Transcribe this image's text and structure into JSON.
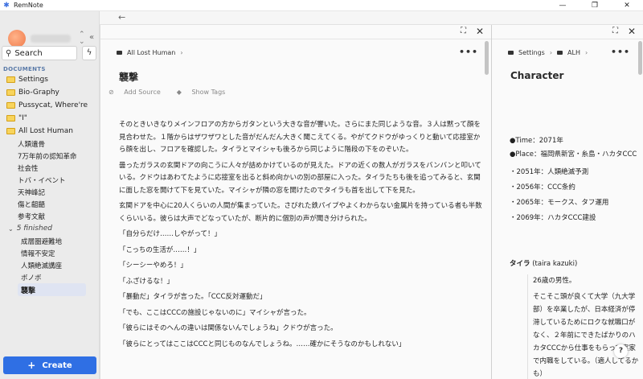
{
  "window": {
    "title": "RemNote",
    "minimize": "—",
    "restore": "❐",
    "close": "✕"
  },
  "sidebar": {
    "search_label": "Search",
    "docs_header": "DOCUMENTS",
    "create_label": "Create",
    "items": [
      {
        "label": "Settings",
        "type": "folder"
      },
      {
        "label": "Bio-Graphy",
        "type": "folder"
      },
      {
        "label": "Pussycat, Where're",
        "type": "folder"
      },
      {
        "label": "\"I\"",
        "type": "folder"
      },
      {
        "label": "All Lost Human",
        "type": "folder"
      }
    ],
    "sub_items": [
      "人類遺骨",
      "7万年前の認知革命",
      "社会性",
      "トバ・イベント",
      "天神峰記",
      "傷と齟齬",
      "参考文献"
    ],
    "finished_label": "5 finished",
    "finished_items": [
      "成層圏避難地",
      "情報不安定",
      "人類絶滅講座",
      "ボノボ"
    ],
    "active_item": "襲撃"
  },
  "main_pane": {
    "breadcrumb": [
      "All Lost Human"
    ],
    "title": "襲撃",
    "add_source": "Add Source",
    "show_tags": "Show Tags",
    "paragraphs": [
      "そのときいきなりメインフロアの方からガタンという大きな音が響いた。さらにまた同じような音。３人は黙って顔を見合わせた。１階からはザワザワとした音がだんだん大きく聞こえてくる。やがてクドウがゆっくりと動いて応接室から顔を出し、フロアを確認した。タイラとマイシャも後ろから同じように階段の下をのぞいた。",
      "曇ったガラスの玄関ドアの向こうに人々が詰めかけているのが見えた。ドアの近くの数人がガラスをバンバンと叩いている。クドウはあわてたように応接室を出ると斜め向かいの別の部屋に入った。タイラたちも後を追ってみると、玄関に面した窓を開けて下を見ていた。マイシャが隣の窓を開けたのでタイラも首を出して下を見た。",
      "玄関ドアを中心に20人くらいの人間が集まっていた。さびれた鉄パイプやよくわからない金属片を持っている者も半数くらいいる。彼らは大声でどなっていたが、断片的に個別の声が聞き分けられた。",
      "「自分らだけ……しやがって！」",
      "「こっちの生活が……！」",
      "「シーシーやめろ！」",
      "「ふざけるな！」",
      "「暴動だ」タイラが言った。「CCC反対運動だ」",
      "「でも、ここはCCCの施設じゃないのに」マイシャが言った。",
      "「彼らにはそのへんの違いは関係ないんでしょうね」クドウが言った。",
      "「彼らにとってはここはCCCと同じものなんでしょうね。……確かにそうなのかもしれない」"
    ]
  },
  "side_pane": {
    "breadcrumb": [
      "Settings",
      "ALH"
    ],
    "title": "Character",
    "lines": [
      "●Time：2071年",
      "●Place：福岡県新宮・糸島・ハカタCCC",
      "・2051年：人類絶滅予測",
      "・2056年：CCC条約",
      "・2065年：モークス、タフ運用",
      "・2069年：ハカタCCC建設"
    ],
    "character_name": "タイラ",
    "character_reading": "(taira kazuki)",
    "character_lines": [
      "26歳の男性。",
      "そこそこ頭が良くて大学（九大学部）を卒業したが、日本経済が停滞しているためにロクな就職口がなく、２年前にできたばかりのハカタCCCから仕事をもらって実家で内職をしている。（適人してるかも）"
    ]
  },
  "help_label": "?"
}
